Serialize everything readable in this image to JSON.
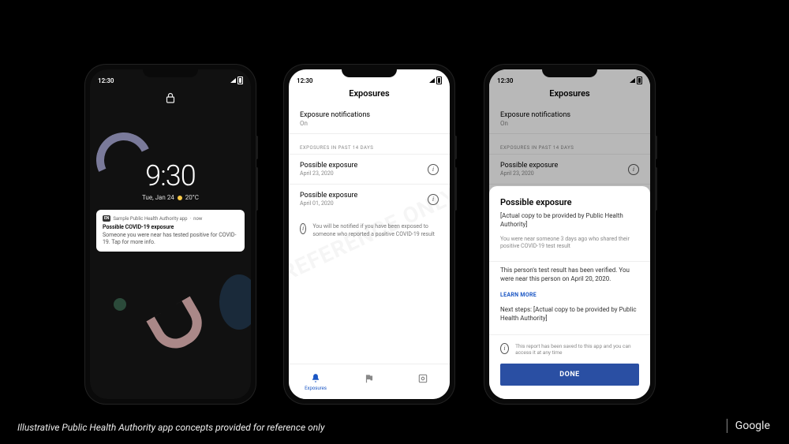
{
  "status": {
    "time": "12:30"
  },
  "phone1": {
    "clock_time": "9:30",
    "clock_date_prefix": "Tue, Jan 24",
    "clock_temp": "20°C",
    "notif_badge": "EN",
    "notif_app": "Sample Public Health Authority app",
    "notif_when": "now",
    "notif_title": "Possible COVID-19 exposure",
    "notif_body": "Someone you were near has tested positive for COVID-19. Tap for more info."
  },
  "phone2": {
    "title": "Exposures",
    "setting_label": "Exposure notifications",
    "setting_value": "On",
    "list_caption": "Exposures in past 14 days",
    "rows": [
      {
        "title": "Possible exposure",
        "date": "April 23, 2020"
      },
      {
        "title": "Possible exposure",
        "date": "April 01, 2020"
      }
    ],
    "note": "You will be notified if you have been exposed to someone who reported a positive COVID-19 result",
    "watermark": "REFERENCE ONLY",
    "tabs": {
      "exposures": "Exposures"
    }
  },
  "phone3": {
    "bg_title": "Exposures",
    "bg_setting_label": "Exposure notifications",
    "bg_setting_value": "On",
    "bg_caption": "Exposures in past 14 days",
    "bg_row_title": "Possible exposure",
    "bg_row_date": "April 23, 2020",
    "sheet_title": "Possible exposure",
    "sheet_p1": "[Actual copy to be provided by Public Health Authority]",
    "sheet_p2": "You were near someone 3 days ago who shared their positive COVID-19 test result",
    "sheet_p3": "This person's test result has been verified. You were near this person on April 20, 2020.",
    "sheet_link": "LEARN MORE",
    "sheet_p4": "Next steps: [Actual copy to be provided by Public Health Authority]",
    "sheet_saved": "This report has been saved to this app and you can access it at any time",
    "done": "DONE"
  },
  "footer": {
    "caption": "Illustrative Public Health Authority app concepts provided for reference only",
    "google": "Google"
  }
}
